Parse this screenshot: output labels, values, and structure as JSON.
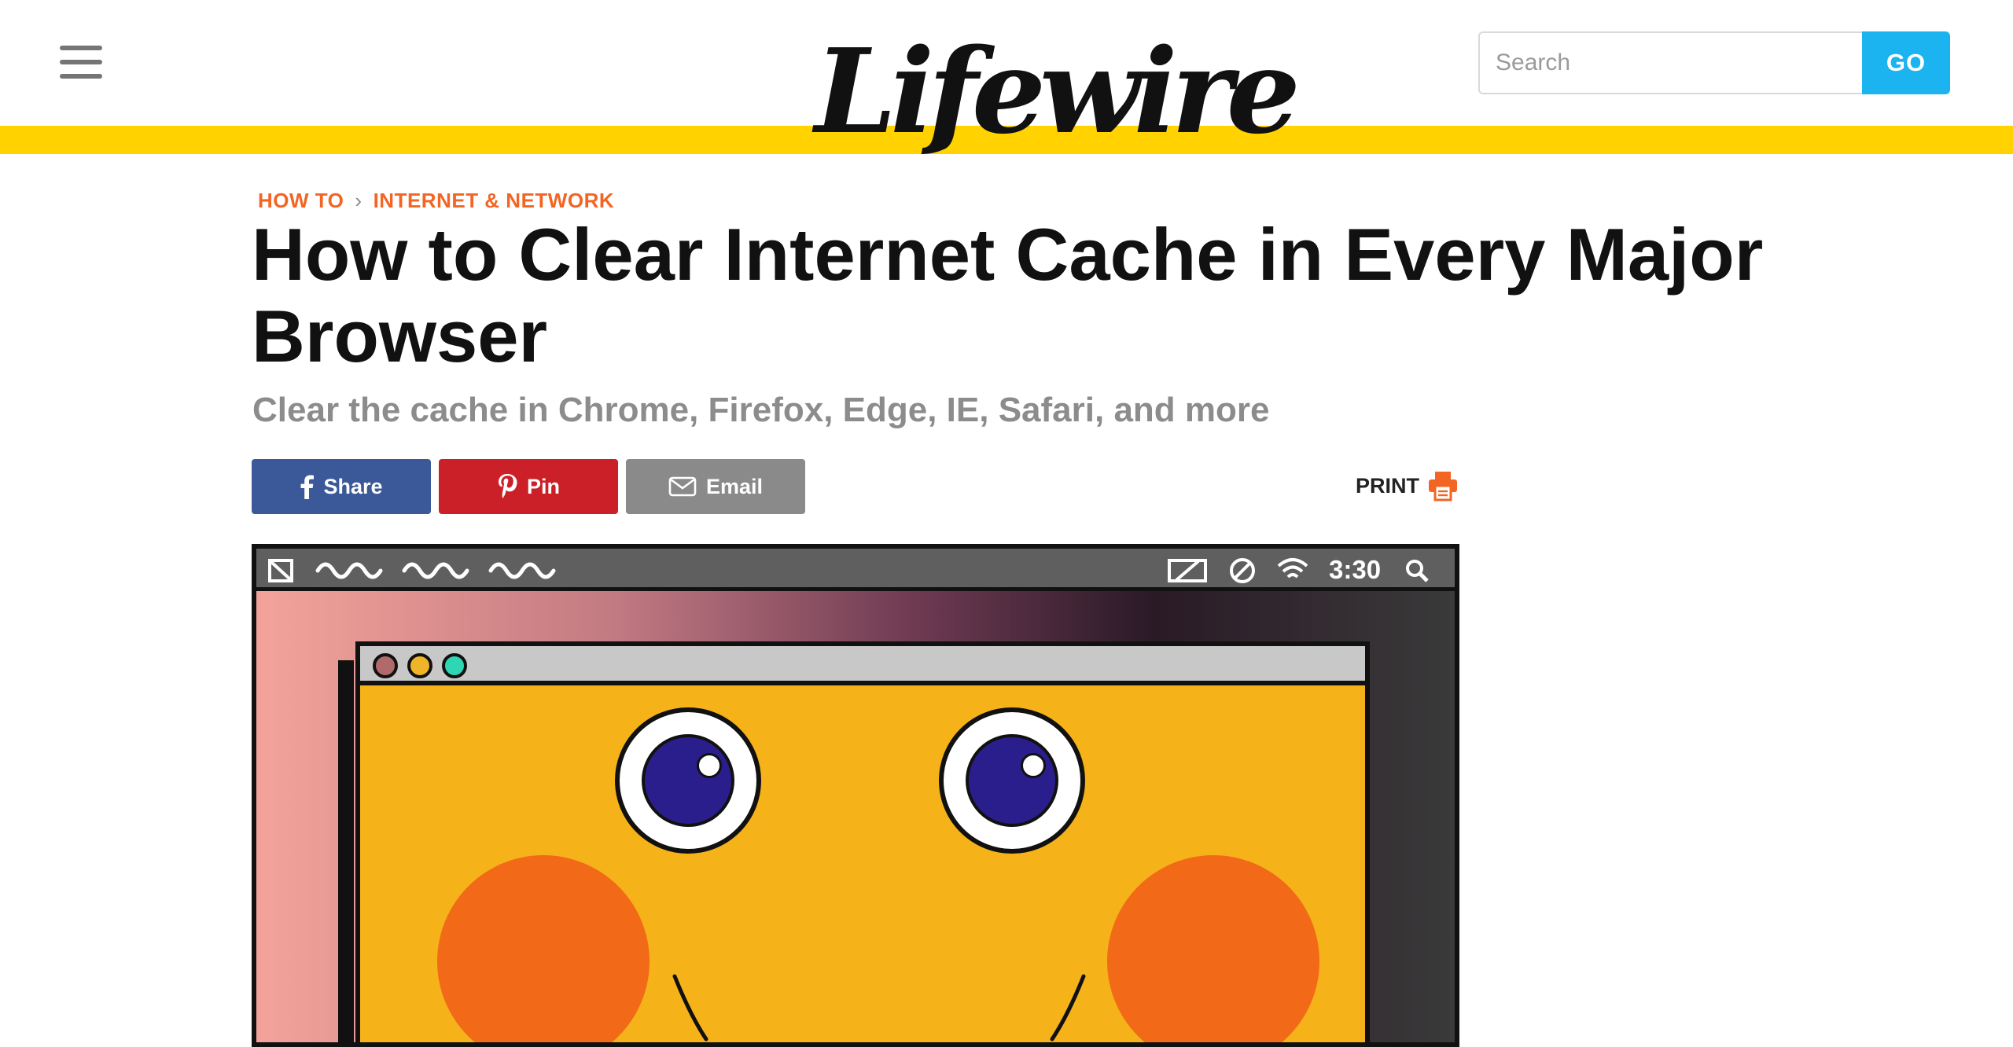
{
  "header": {
    "menu_icon": "hamburger-menu-icon",
    "logo_text": "Lifewire",
    "search": {
      "placeholder": "Search",
      "value": "",
      "go_label": "GO"
    },
    "colors": {
      "accent_bar": "#ffd200",
      "go_button": "#1bb4f0"
    }
  },
  "breadcrumb": {
    "items": [
      "HOW TO",
      "INTERNET & NETWORK"
    ],
    "separator_icon": "chevron-right-icon",
    "color": "#f26522"
  },
  "article": {
    "title": "How to Clear Internet Cache in Every Major Browser",
    "subtitle": "Clear the cache in Chrome, Firefox, Edge, IE, Safari, and more"
  },
  "share_bar": {
    "share_label": "Share",
    "pin_label": "Pin",
    "email_label": "Email",
    "print_label": "PRINT",
    "icons": [
      "facebook-icon",
      "pinterest-icon",
      "envelope-icon",
      "printer-icon"
    ],
    "colors": {
      "share": "#3b5998",
      "pin": "#cb2027",
      "email": "#8a8a8a",
      "print_icon": "#f26522"
    }
  },
  "hero": {
    "description_icon": "happy-browser-window-illustration",
    "menubar_clock": "3:30",
    "menubar_icons": [
      "apple-logo-icon",
      "squiggle-menu-icon",
      "cast-icon",
      "do-not-disturb-icon",
      "wifi-icon",
      "search-icon"
    ],
    "window_dots": [
      "#b06a6a",
      "#f0b429",
      "#2fd6b4"
    ]
  }
}
